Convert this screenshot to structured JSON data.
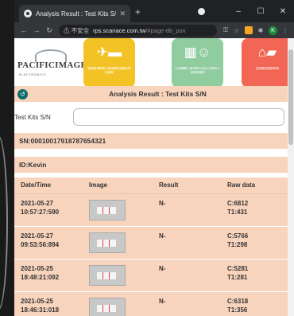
{
  "browser": {
    "tab_title": "Analysis Result : Test Kits S/N",
    "security": "不安全",
    "host": "rps.scanace.com.tw",
    "path": "/#page-db_psn",
    "profile_initial": "K"
  },
  "logo": {
    "brand": "PACIFICIMAGE",
    "sub": "ELECTRONICS"
  },
  "cards": [
    {
      "icon": "airplane-train-icon",
      "text": "機場高鐵轉乘之無接觸快速篩檢預約服務"
    },
    {
      "icon": "building-icon",
      "text": "公司機關/工廠/學校/大型公共場所人員篩檢服務"
    },
    {
      "icon": "house-truck-icon",
      "text": "居家篩檢服務申請"
    }
  ],
  "page": {
    "title": "Analysis Result : Test Kits S/N",
    "sn_label": "Test Kits S/N",
    "sn_value": "",
    "sn_line": "SN:00010017918787654321",
    "id_line": "ID:Kevin"
  },
  "table": {
    "headers": [
      "Date/Time",
      "Image",
      "Result",
      "Raw data"
    ],
    "rows": [
      {
        "date": "2021-05-27",
        "time": "10:57:27:590",
        "result": "N-",
        "c": "C:6812",
        "t": "T1:431"
      },
      {
        "date": "2021-05-27",
        "time": "09:53:56:894",
        "result": "N-",
        "c": "C:5766",
        "t": "T1:298"
      },
      {
        "date": "2021-05-25",
        "time": "18:48:21:092",
        "result": "N-",
        "c": "C:5281",
        "t": "T1:281"
      },
      {
        "date": "2021-05-25",
        "time": "18:46:31:018",
        "result": "N-",
        "c": "C:6318",
        "t": "T1:356"
      }
    ]
  },
  "colors": {
    "accent": "#f9d4bd",
    "card_yellow": "#f3c325",
    "card_green": "#8fcc9e",
    "card_red": "#f26656",
    "back_button": "#0f6a6a"
  }
}
